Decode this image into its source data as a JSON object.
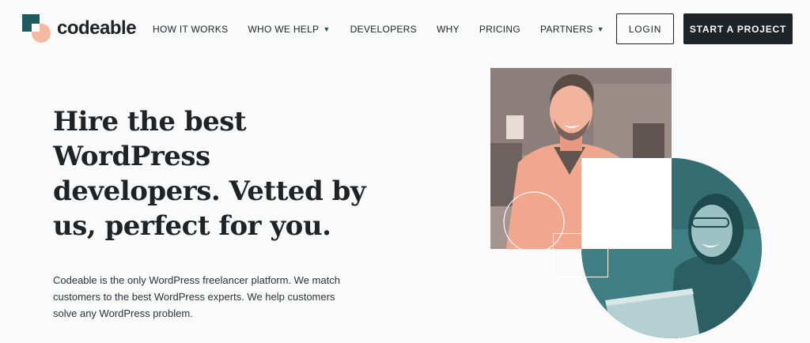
{
  "brand": {
    "name": "codeable"
  },
  "nav": {
    "items": [
      {
        "label": "HOW IT WORKS",
        "dropdown": false
      },
      {
        "label": "WHO WE HELP",
        "dropdown": true
      },
      {
        "label": "DEVELOPERS",
        "dropdown": false
      },
      {
        "label": "WHY",
        "dropdown": false
      },
      {
        "label": "PRICING",
        "dropdown": false
      },
      {
        "label": "PARTNERS",
        "dropdown": true
      }
    ],
    "login_label": "LOGIN",
    "cta_label": "START A PROJECT"
  },
  "hero": {
    "title": "Hire the best WordPress developers. Vetted by us, perfect for you.",
    "description": "Codeable is the only WordPress freelancer platform. We match customers to the best WordPress experts. We help customers solve any WordPress problem."
  },
  "colors": {
    "teal": "#1e5a5e",
    "peach": "#f4b9a1",
    "dark": "#1d2327"
  }
}
